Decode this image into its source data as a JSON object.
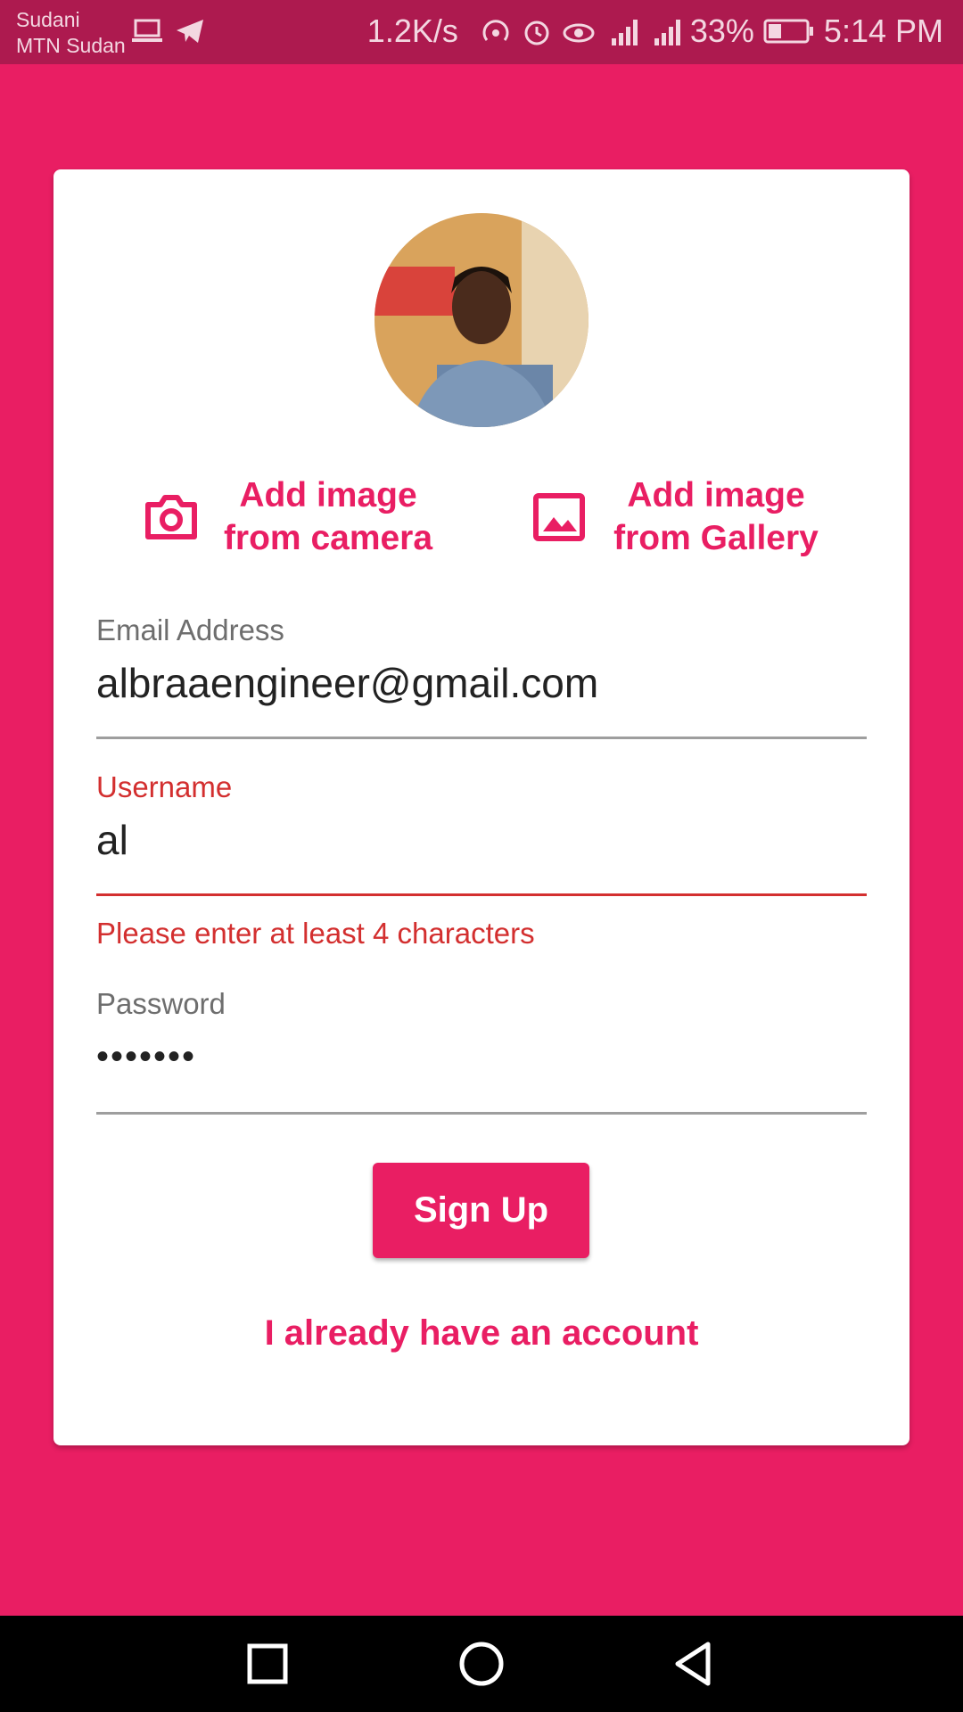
{
  "status_bar": {
    "carrier_line1": "Sudani",
    "carrier_line2": "MTN Sudan",
    "net_speed": "1.2K/s",
    "battery": "33%",
    "time": "5:14 PM"
  },
  "profile": {
    "avatar_icon": "user-photo"
  },
  "image_actions": {
    "camera_line1": "Add image",
    "camera_line2": "from camera",
    "gallery_line1": "Add image",
    "gallery_line2": "from Gallery"
  },
  "form": {
    "email_label": "Email Address",
    "email_value": "albraaengineer@gmail.com",
    "username_label": "Username",
    "username_value": "al",
    "username_error": "Please enter at least 4 characters",
    "password_label": "Password",
    "password_value": "•••••••"
  },
  "actions": {
    "signup_label": "Sign Up",
    "login_link": "I already have an account"
  },
  "colors": {
    "primary": "#e91e63",
    "status_bar": "#ad1a4f",
    "error": "#d32f2f"
  }
}
